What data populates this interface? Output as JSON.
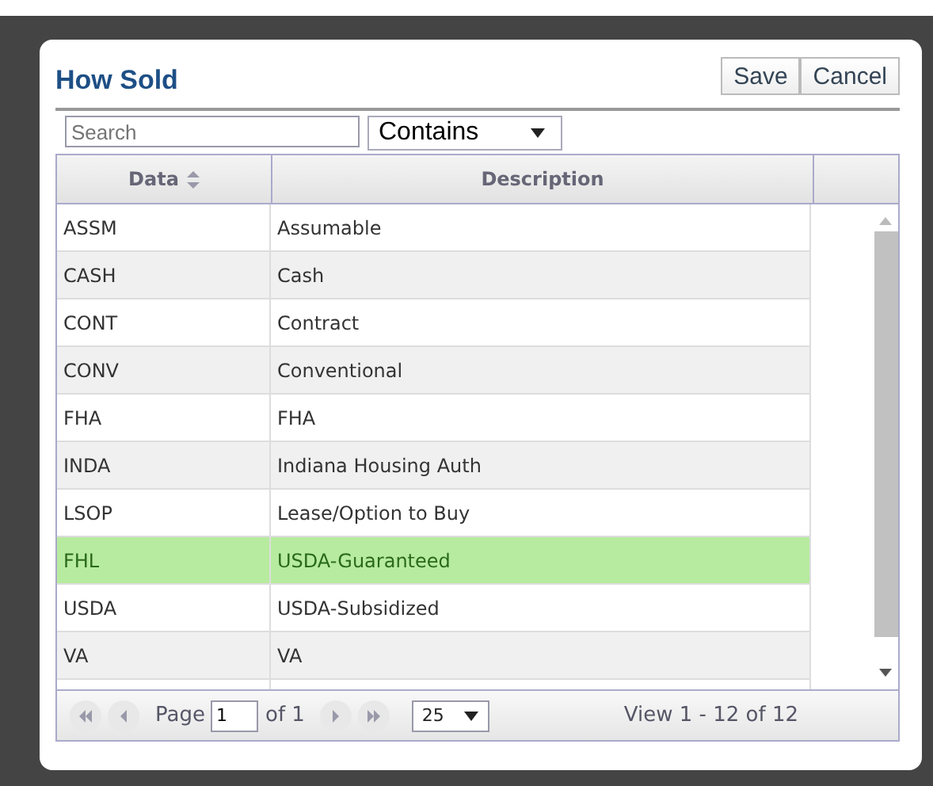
{
  "dialog": {
    "title": "How Sold",
    "buttons": [
      "Save",
      "Cancel"
    ]
  },
  "filter": {
    "placeholder": "Search",
    "mode": "Contains"
  },
  "table": {
    "columns": [
      {
        "label": "Data",
        "sortable": true
      },
      {
        "label": "Description",
        "sortable": false
      }
    ],
    "rows": [
      {
        "data": "ASSM",
        "description": "Assumable",
        "selected": false
      },
      {
        "data": "CASH",
        "description": "Cash",
        "selected": false
      },
      {
        "data": "CONT",
        "description": "Contract",
        "selected": false
      },
      {
        "data": "CONV",
        "description": "Conventional",
        "selected": false
      },
      {
        "data": "FHA",
        "description": "FHA",
        "selected": false
      },
      {
        "data": "INDA",
        "description": "Indiana Housing Auth",
        "selected": false
      },
      {
        "data": "LSOP",
        "description": "Lease/Option to Buy",
        "selected": false
      },
      {
        "data": "FHL",
        "description": "USDA-Guaranteed",
        "selected": true
      },
      {
        "data": "USDA",
        "description": "USDA-Subsidized",
        "selected": false
      },
      {
        "data": "VA",
        "description": "VA",
        "selected": false
      }
    ]
  },
  "pager": {
    "page_label": "Page",
    "page": "1",
    "of": "of 1",
    "page_size": "25",
    "summary": "View 1 - 12 of 12"
  }
}
